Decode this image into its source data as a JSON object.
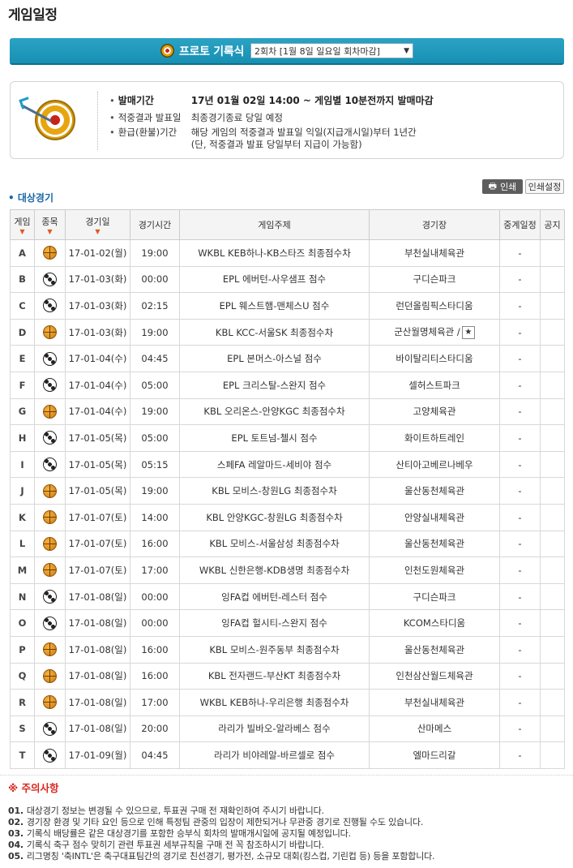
{
  "page": {
    "title": "게임일정"
  },
  "round_bar": {
    "title": "프로토 기록식",
    "selected_round": "2회차 [1월 8일 일요일 회차마감]",
    "caret": "▼"
  },
  "info": {
    "rows": [
      {
        "label": "발매기간",
        "value": "17년 01월 02일 14:00 ~ 게임별 10분전까지 발매마감"
      },
      {
        "label": "적중결과 발표일",
        "value": "최종경기종료 당일 예정"
      },
      {
        "label": "환급(환불)기간",
        "value": "해당 게임의 적중결과 발표일 익일(지급개시일)부터 1년간"
      },
      {
        "label": "",
        "value": "(단, 적중결과 발표 당일부터 지급이 가능함)"
      }
    ]
  },
  "buttons": {
    "print": "인쇄",
    "print_setting": "인쇄설정"
  },
  "section": {
    "label": "• 대상경기"
  },
  "table": {
    "headers": {
      "game": "게임",
      "sport": "종목",
      "date": "경기일",
      "time": "경기시간",
      "subject": "게임주제",
      "venue": "경기장",
      "relay": "중계일정",
      "notice": "공지"
    },
    "sort_arrow": "▼",
    "rows": [
      {
        "game": "A",
        "sport": "basketball",
        "date": "17-01-02(월)",
        "time": "19:00",
        "subject": "WKBL KEB하나-KB스타즈 최종점수차",
        "venue": "부천실내체육관",
        "relay": "-"
      },
      {
        "game": "B",
        "sport": "soccer",
        "date": "17-01-03(화)",
        "time": "00:00",
        "subject": "EPL 에버턴-사우샘프 점수",
        "venue": "구디슨파크",
        "relay": "-"
      },
      {
        "game": "C",
        "sport": "soccer",
        "date": "17-01-03(화)",
        "time": "02:15",
        "subject": "EPL 웨스트햄-맨체스U 점수",
        "venue": "런던올림픽스타디움",
        "relay": "-"
      },
      {
        "game": "D",
        "sport": "basketball",
        "date": "17-01-03(화)",
        "time": "19:00",
        "subject": "KBL KCC-서울SK 최종점수차",
        "venue": "군산월명체육관 /",
        "venue_star": "★",
        "relay": "-"
      },
      {
        "game": "E",
        "sport": "soccer",
        "date": "17-01-04(수)",
        "time": "04:45",
        "subject": "EPL 본머스-아스널 점수",
        "venue": "바이탈리티스타디움",
        "relay": "-"
      },
      {
        "game": "F",
        "sport": "soccer",
        "date": "17-01-04(수)",
        "time": "05:00",
        "subject": "EPL 크리스탈-스완지 점수",
        "venue": "셀허스트파크",
        "relay": "-"
      },
      {
        "game": "G",
        "sport": "basketball",
        "date": "17-01-04(수)",
        "time": "19:00",
        "subject": "KBL 오리온스-안양KGC 최종점수차",
        "venue": "고양체육관",
        "relay": "-"
      },
      {
        "game": "H",
        "sport": "soccer",
        "date": "17-01-05(목)",
        "time": "05:00",
        "subject": "EPL 토트넘-첼시 점수",
        "venue": "화이트하트레인",
        "relay": "-"
      },
      {
        "game": "I",
        "sport": "soccer",
        "date": "17-01-05(목)",
        "time": "05:15",
        "subject": "스페FA 레알마드-세비야 점수",
        "venue": "산티아고베르나베우",
        "relay": "-"
      },
      {
        "game": "J",
        "sport": "basketball",
        "date": "17-01-05(목)",
        "time": "19:00",
        "subject": "KBL 모비스-창원LG 최종점수차",
        "venue": "울산동천체육관",
        "relay": "-"
      },
      {
        "game": "K",
        "sport": "basketball",
        "date": "17-01-07(토)",
        "time": "14:00",
        "subject": "KBL 안양KGC-창원LG 최종점수차",
        "venue": "안양실내체육관",
        "relay": "-"
      },
      {
        "game": "L",
        "sport": "basketball",
        "date": "17-01-07(토)",
        "time": "16:00",
        "subject": "KBL 모비스-서울삼성 최종점수차",
        "venue": "울산동천체육관",
        "relay": "-"
      },
      {
        "game": "M",
        "sport": "basketball",
        "date": "17-01-07(토)",
        "time": "17:00",
        "subject": "WKBL 신한은행-KDB생명 최종점수차",
        "venue": "인천도원체육관",
        "relay": "-"
      },
      {
        "game": "N",
        "sport": "soccer",
        "date": "17-01-08(일)",
        "time": "00:00",
        "subject": "잉FA컵 에버턴-레스터 점수",
        "venue": "구디슨파크",
        "relay": "-"
      },
      {
        "game": "O",
        "sport": "soccer",
        "date": "17-01-08(일)",
        "time": "00:00",
        "subject": "잉FA컵 헐시티-스완지 점수",
        "venue": "KCOM스타디움",
        "relay": "-"
      },
      {
        "game": "P",
        "sport": "basketball",
        "date": "17-01-08(일)",
        "time": "16:00",
        "subject": "KBL 모비스-원주동부 최종점수차",
        "venue": "울산동천체육관",
        "relay": "-"
      },
      {
        "game": "Q",
        "sport": "basketball",
        "date": "17-01-08(일)",
        "time": "16:00",
        "subject": "KBL 전자랜드-부산KT 최종점수차",
        "venue": "인천삼산월드체육관",
        "relay": "-"
      },
      {
        "game": "R",
        "sport": "basketball",
        "date": "17-01-08(일)",
        "time": "17:00",
        "subject": "WKBL KEB하나-우리은행 최종점수차",
        "venue": "부천실내체육관",
        "relay": "-"
      },
      {
        "game": "S",
        "sport": "soccer",
        "date": "17-01-08(일)",
        "time": "20:00",
        "subject": "라리가 빌바오-알라베스 점수",
        "venue": "산마메스",
        "relay": "-"
      },
      {
        "game": "T",
        "sport": "soccer",
        "date": "17-01-09(월)",
        "time": "04:45",
        "subject": "라리가 비야레알-바르셀로 점수",
        "venue": "엘마드리갈",
        "relay": "-"
      }
    ]
  },
  "notice": {
    "title": "※ 주의사항",
    "items": [
      {
        "num": "01.",
        "text": "대상경기 정보는 변경될 수 있으므로, 투표권 구매 전 재확인하여 주시기 바랍니다."
      },
      {
        "num": "02.",
        "text": "경기장 환경 및 기타 요인 등으로 인해 특정팀 관중의 입장이 제한되거나 무관중 경기로 진행될 수도 있습니다."
      },
      {
        "num": "03.",
        "text": "기록식 배당률은 같은 대상경기를 포함한 승부식 회차의 발매개시일에 공지될 예정입니다."
      },
      {
        "num": "04.",
        "text": "기록식 축구 점수 맞히기 관련 투표권 세부규칙을 구매 전 꼭 참조하시기 바랍니다."
      },
      {
        "num": "05.",
        "text": "리그명칭 '축INTL'은 축구대표팀간의 경기로 친선경기, 평가전, 소규모 대회(킹스컵, 기린컵 등) 등을 포함합니다."
      }
    ]
  },
  "colors": {
    "accent": "#1a90b4",
    "section": "#1a68a8",
    "warning": "#d8261d"
  }
}
